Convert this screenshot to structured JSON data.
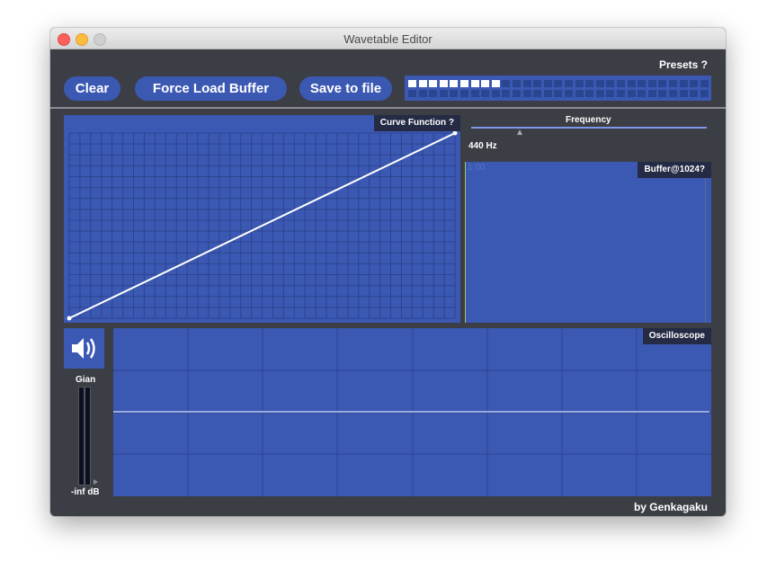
{
  "window": {
    "title": "Wavetable Editor"
  },
  "toolbar": {
    "clear_label": "Clear",
    "force_load_label": "Force Load Buffer",
    "save_label": "Save to file",
    "presets_label": "Presets ?",
    "preset_slots_active": 9,
    "preset_slots_total": 29
  },
  "curve": {
    "label": "Curve Function ?"
  },
  "frequency": {
    "label": "Frequency",
    "value_text": "440 Hz"
  },
  "buffer": {
    "label": "Buffer@1024?",
    "corner_text": "1.00"
  },
  "oscilloscope": {
    "label": "Oscilloscope"
  },
  "gain": {
    "label": "Gian",
    "level_text": "-inf dB",
    "icon": "speaker-icon"
  },
  "footer": {
    "credit": "by Genkagaku"
  },
  "colors": {
    "panel": "#3b58b3",
    "background": "#3c3e45",
    "tag": "#252a45"
  }
}
